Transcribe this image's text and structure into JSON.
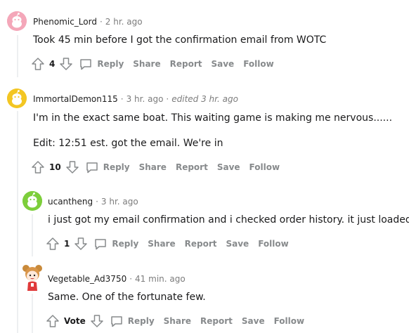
{
  "colors": {
    "avatar_pink": "#f4a7b9",
    "avatar_yellow": "#f3c623",
    "avatar_green": "#7dce3b",
    "meta_gray": "#7c7c7c",
    "action_gray": "#878a8c",
    "thread_line": "#edeff1"
  },
  "actions": {
    "reply": "Reply",
    "share": "Share",
    "report": "Report",
    "save": "Save",
    "follow": "Follow"
  },
  "comments": [
    {
      "username": "Phenomic_Lord",
      "time": "2 hr. ago",
      "body": [
        "Took 45 min before I got the confirmation email from WOTC"
      ],
      "votes": "4",
      "avatar": "snoo-pink-avatar"
    },
    {
      "username": "ImmortalDemon115",
      "time": "3 hr. ago",
      "edited": "edited 3 hr. ago",
      "body": [
        "I'm in the exact same boat. This waiting game is making me nervous......",
        "Edit: 12:51 est. got the email. We're in"
      ],
      "votes": "10",
      "avatar": "snoo-yellow-avatar"
    },
    {
      "username": "ucantheng",
      "time": "3 hr. ago",
      "body": [
        "i just got my email confirmation and i checked order history. it just loaded in"
      ],
      "votes": "1",
      "avatar": "snoo-green-avatar"
    },
    {
      "username": "Vegetable_Ad3750",
      "time": "41 min. ago",
      "body": [
        "Same. One of the fortunate few."
      ],
      "votes": "Vote",
      "avatar": "custom-girl-avatar"
    }
  ]
}
